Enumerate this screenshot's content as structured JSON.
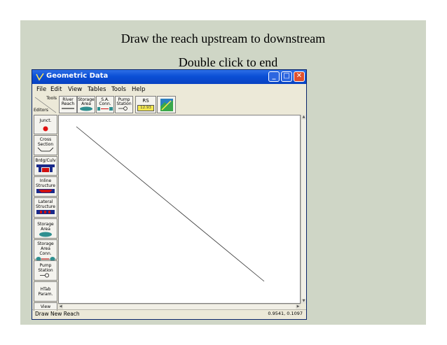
{
  "slide": {
    "line1": "Draw the reach upstream to downstream",
    "line2": "Double click to end"
  },
  "window": {
    "title": "Geometric Data",
    "title_icon": "geometry-app-icon",
    "controls": {
      "minimize": "_",
      "maximize": "□",
      "close": "✕"
    }
  },
  "menu": [
    "File",
    "Edit",
    "View",
    "Tables",
    "Tools",
    "Help"
  ],
  "toolbar": {
    "tools_label": "Tools",
    "editors_label": "Editors",
    "river_reach": [
      "River",
      "Reach"
    ],
    "storage_area": [
      "Storage",
      "Area"
    ],
    "sa_conn": [
      "S.A.",
      "Conn."
    ],
    "pump_station": [
      "Pump",
      "Station"
    ],
    "rs": "RS",
    "rs_badge": "12.93"
  },
  "editors": {
    "junct": "Junct.",
    "cross_section": [
      "Cross",
      "Section"
    ],
    "brdg_culv": "Brdg/Culv",
    "inline_structure": [
      "Inline",
      "Structure"
    ],
    "lateral_structure": [
      "Lateral",
      "Structure"
    ],
    "storage_area": [
      "Storage",
      "Area"
    ],
    "storage_area_conn": [
      "Storage",
      "Area Conn."
    ],
    "pump_station": [
      "Pump",
      "Station"
    ],
    "htab_param": [
      "HTab",
      "Param."
    ],
    "view": "View"
  },
  "status": {
    "mode": "Draw New Reach",
    "coords": "0.9541, 0.1097"
  },
  "colors": {
    "slide_bg": "#cfd6c6",
    "titlebar": "#0b4fd6",
    "junction_dot": "#e01010",
    "storage_fill": "#2f8f8f",
    "rs_badge_bg": "#f4e850"
  }
}
